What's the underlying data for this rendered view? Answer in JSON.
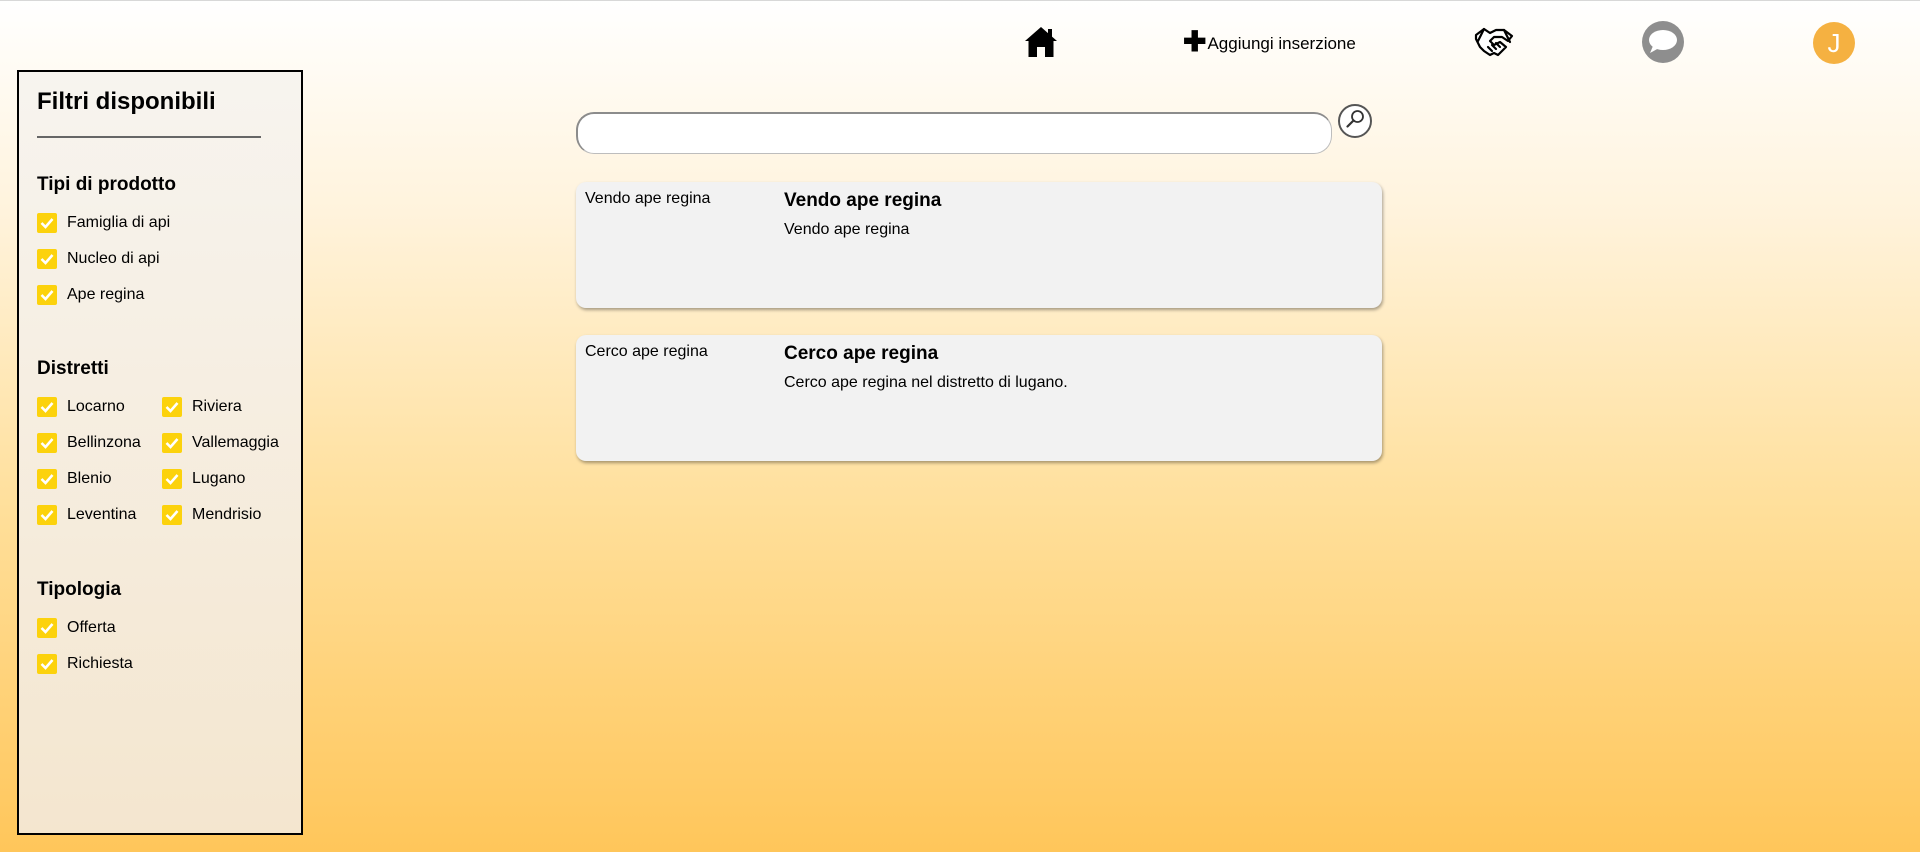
{
  "nav": {
    "home_icon": "home-icon",
    "add_label": "Aggiungi inserzione",
    "add_icon_glyph": "✚",
    "deals_icon": "handshake-icon",
    "chat_icon": "chat-bubble-icon",
    "avatar_initial": "J",
    "avatar_color": "#f5b141"
  },
  "sidebar": {
    "title": "Filtri disponibili",
    "sections": {
      "product_types": {
        "title": "Tipi di prodotto",
        "items": [
          "Famiglia di api",
          "Nucleo di api",
          "Ape regina"
        ]
      },
      "districts": {
        "title": "Distretti",
        "items": [
          "Locarno",
          "Riviera",
          "Bellinzona",
          "Vallemaggia",
          "Blenio",
          "Lugano",
          "Leventina",
          "Mendrisio"
        ]
      },
      "type": {
        "title": "Tipologia",
        "items": [
          "Offerta",
          "Richiesta"
        ]
      }
    },
    "checkbox_color": "#fcd20c"
  },
  "search": {
    "value": "",
    "placeholder": ""
  },
  "listings": [
    {
      "image_alt": "Vendo ape regina",
      "title": "Vendo ape regina",
      "description": "Vendo ape regina"
    },
    {
      "image_alt": "Cerco ape regina",
      "title": "Cerco ape regina",
      "description": "Cerco ape regina nel distretto di lugano."
    }
  ]
}
